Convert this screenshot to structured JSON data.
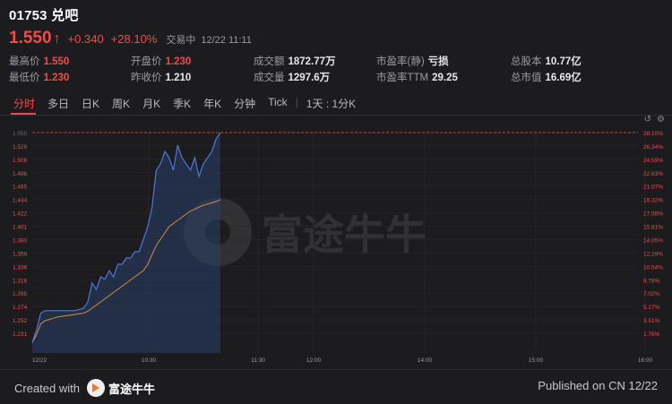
{
  "stock": {
    "code": "01753",
    "name": "兑吧",
    "price": "1.550",
    "arrow": "↑",
    "change": "+0.340",
    "change_pct": "+28.10%",
    "status": "交易中",
    "time": "12/22 11:11"
  },
  "stats": {
    "high_label": "最高价",
    "high": "1.550",
    "low_label": "最低价",
    "low": "1.230",
    "open_label": "开盘价",
    "open": "1.230",
    "prev_label": "昨收价",
    "prev": "1.210",
    "turnover_label": "成交额",
    "turnover": "1872.77万",
    "volume_label": "成交量",
    "volume": "1297.6万",
    "pe_static_label": "市盈率(静)",
    "pe_static": "亏损",
    "pe_ttm_label": "市盈率TTM",
    "pe_ttm": "29.25",
    "shares_label": "总股本",
    "shares": "10.77亿",
    "mcap_label": "总市值",
    "mcap": "16.69亿"
  },
  "tabs": [
    "分时",
    "多日",
    "日K",
    "周K",
    "月K",
    "季K",
    "年K",
    "分钟",
    "Tick"
  ],
  "tab_extra": "1天 : 1分K",
  "icons": {
    "refresh": "↺",
    "settings": "⚙"
  },
  "chart_data": {
    "type": "line",
    "title": "",
    "xlabel": "",
    "ylabel": "",
    "x_ticks": [
      "12/22",
      "10:30",
      "11:30",
      "12:00",
      "14:00",
      "15:00",
      "16:00"
    ],
    "y_ticks": [
      "1.550",
      "1.529",
      "1.508",
      "1.486",
      "1.465",
      "1.444",
      "1.422",
      "1.401",
      "1.380",
      "1.359",
      "1.338",
      "1.316",
      "1.295",
      "1.274",
      "1.252",
      "1.231"
    ],
    "pct_ticks": [
      "28.10%",
      "26.34%",
      "24.59%",
      "22.83%",
      "21.07%",
      "19.32%",
      "17.56%",
      "15.81%",
      "14.05%",
      "12.29%",
      "10.54%",
      "8.78%",
      "7.02%",
      "5.27%",
      "3.51%",
      "1.76%"
    ],
    "ylim": [
      1.21,
      1.55
    ],
    "prev_close": 1.21,
    "series": [
      {
        "role": "price",
        "color": "#4a78d8",
        "values": [
          1.215,
          1.236,
          1.262,
          1.266,
          1.266,
          1.266,
          1.266,
          1.266,
          1.266,
          1.266,
          1.266,
          1.268,
          1.27,
          1.28,
          1.31,
          1.3,
          1.32,
          1.316,
          1.33,
          1.32,
          1.34,
          1.34,
          1.35,
          1.35,
          1.36,
          1.36,
          1.38,
          1.4,
          1.43,
          1.49,
          1.5,
          1.52,
          1.51,
          1.49,
          1.53,
          1.51,
          1.5,
          1.49,
          1.51,
          1.48,
          1.5,
          1.51,
          1.52,
          1.54,
          1.55
        ]
      },
      {
        "role": "average",
        "color": "#d98a45",
        "values": [
          1.215,
          1.228,
          1.245,
          1.25,
          1.252,
          1.254,
          1.256,
          1.257,
          1.258,
          1.259,
          1.26,
          1.261,
          1.262,
          1.265,
          1.27,
          1.275,
          1.28,
          1.285,
          1.29,
          1.295,
          1.3,
          1.305,
          1.31,
          1.315,
          1.32,
          1.325,
          1.33,
          1.34,
          1.355,
          1.37,
          1.38,
          1.39,
          1.4,
          1.405,
          1.41,
          1.415,
          1.42,
          1.425,
          1.428,
          1.431,
          1.434,
          1.436,
          1.438,
          1.44,
          1.443
        ]
      }
    ]
  },
  "footer": {
    "created_with": "Created with",
    "brand": "富途牛牛",
    "published": "Published on CN 12/22"
  }
}
